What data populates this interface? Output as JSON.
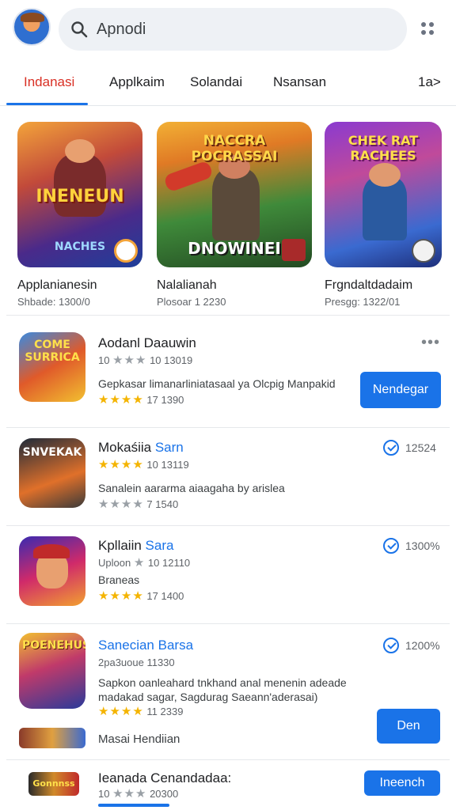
{
  "search": {
    "placeholder": "Apnodi"
  },
  "tabs": [
    {
      "label": "Indanasi"
    },
    {
      "label": "Applkaim"
    },
    {
      "label": "Solandai"
    },
    {
      "label": "Nsansan"
    },
    {
      "label": "1a>"
    }
  ],
  "featured": [
    {
      "title": "Applanianesin",
      "sub": "Shbade: 1300/0",
      "art_text": "INENEUN",
      "art_sub": "NACHES"
    },
    {
      "title": "Nalalianah",
      "sub": "Plosoar 1 2230",
      "art_text": "NACCRA POCRASSAI",
      "art_sub": "DNOWINEI"
    },
    {
      "title": "Frgndaltdadaim",
      "sub": "Presgg: 1322/01",
      "art_text": "CHEK RAT RACHEES",
      "art_sub": ""
    }
  ],
  "list": [
    {
      "name": "Aodanl Daauwin",
      "meta": "10",
      "meta2": "10 13019",
      "desc": "Gepkasar limanarliniatasaal ya Olcpig Manpakid",
      "rating": "17 1390",
      "button": "Nendegar",
      "icon_text": "COME SURRICA"
    },
    {
      "name_a": "Mokaśiia ",
      "name_b": "Sarn",
      "meta": "10 13119",
      "desc": "Sanalein aararma aiaagaha by arislea",
      "rating": "7 1540",
      "dl": "12524",
      "icon_text": "SNVEKAK"
    },
    {
      "name_a": "Kpllaiin ",
      "name_b": "Sara",
      "meta": "Uploon",
      "meta2": "10 12110",
      "desc": "Braneas",
      "rating": "17 1400",
      "dl": "1300%",
      "icon_text": ""
    },
    {
      "name": "Sanecian Barsa",
      "meta": "2pa3uoue 11330",
      "desc": "Sapkon oanleahard tnkhand anal menenin adeade madakad sagar, Sagdurag Saeann'aderasai)",
      "rating": "11 2339",
      "dl": "1200%",
      "button": "Den",
      "icon_text": "POENEHUS"
    }
  ],
  "mini_row": {
    "label": "Masai Hendiian"
  },
  "bottom_row": {
    "name": "Ieanada Cenandadaa:",
    "meta": "10",
    "meta2": "20300",
    "button": "Ineench",
    "icon_text": "Gonnnss"
  },
  "colors": {
    "accent": "#1a73e8",
    "active_tab": "#d93025",
    "star": "#f4b400"
  }
}
